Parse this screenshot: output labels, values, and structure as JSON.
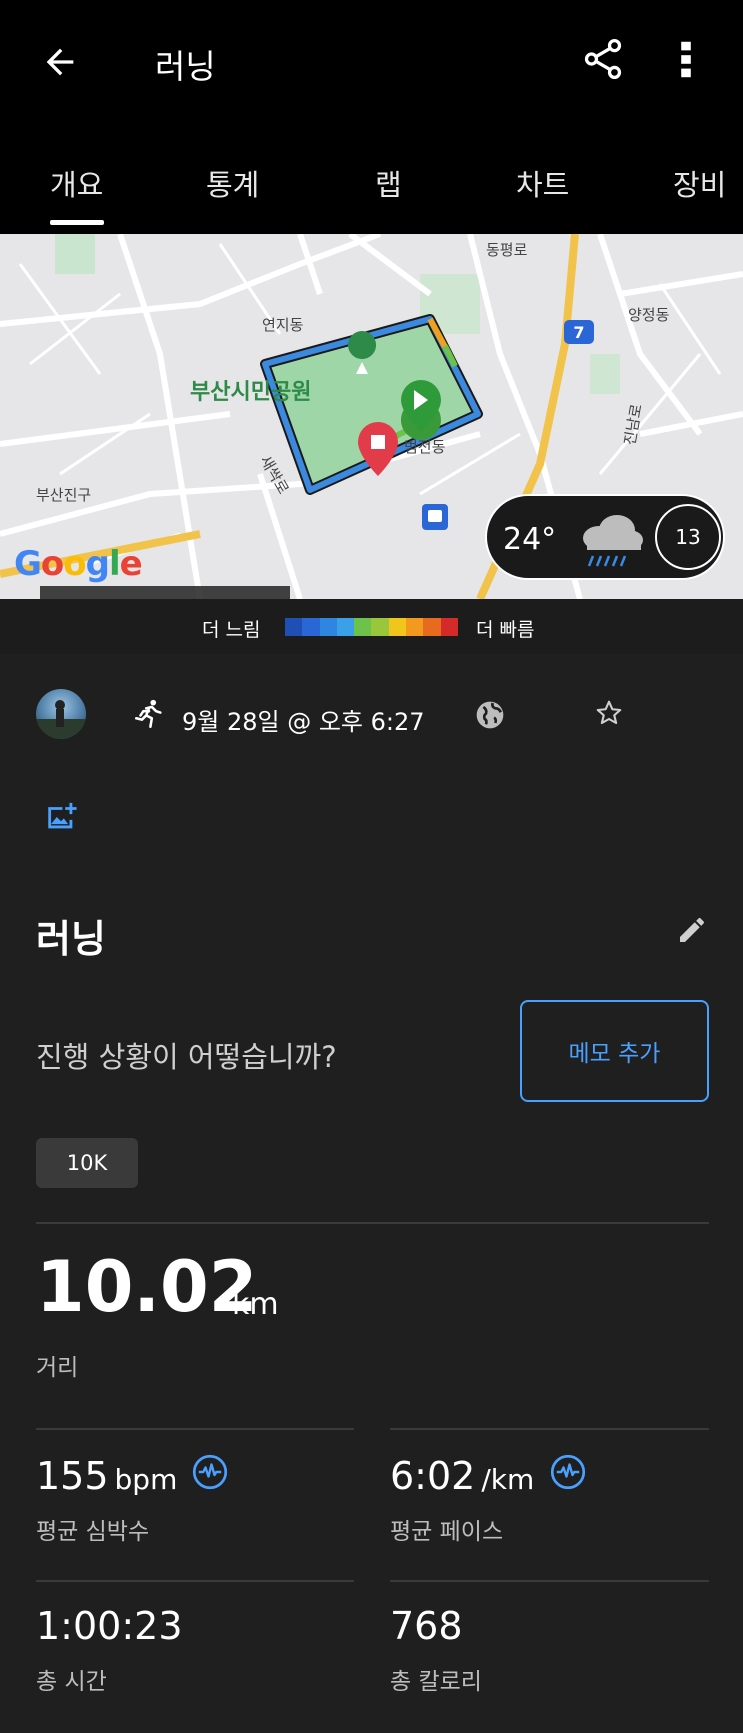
{
  "header": {
    "title": "러닝",
    "back_icon": "arrow-back-icon",
    "share_icon": "share-icon",
    "more_icon": "more-vert-icon"
  },
  "tabs": [
    {
      "label": "개요",
      "active": true
    },
    {
      "label": "통계"
    },
    {
      "label": "랩"
    },
    {
      "label": "차트"
    },
    {
      "label": "장비"
    }
  ],
  "map": {
    "labels": {
      "dongpyeong_ro": "동평로",
      "yeonji_dong": "연지동",
      "yangjeong_dong": "양정동",
      "citizen_park": "부산시민공원",
      "beomjeon_dong": "범전동",
      "busanjin_gu": "부산진구",
      "saebyeok_ro": "새싹로",
      "jinnam_ro": "진남로",
      "road_number": "7",
      "google": "Google"
    },
    "weather": {
      "temperature": "24°",
      "wind": "13",
      "icon": "rain-cloud-icon"
    }
  },
  "legend": {
    "slow_label": "더 느림",
    "fast_label": "더 빠름",
    "colors": [
      "#1f4fb5",
      "#2a66d6",
      "#2f86e0",
      "#3aa0e8",
      "#6cc24a",
      "#9ac63b",
      "#f0c51c",
      "#f39a1e",
      "#e86a1f",
      "#d42a2a"
    ]
  },
  "activity": {
    "datetime": "9월 28일 @ 오후 6:27",
    "name": "러닝",
    "question": "진행 상황이 어떻습니까?",
    "memo_button": "메모 추가",
    "tag": "10K"
  },
  "stats": {
    "distance": {
      "value": "10.02",
      "unit": "km",
      "label": "거리"
    },
    "avg_hr": {
      "value": "155",
      "unit": "bpm",
      "label": "평균 심박수"
    },
    "avg_pace": {
      "value": "6:02",
      "unit": "/km",
      "label": "평균 페이스"
    },
    "total_time": {
      "value": "1:00:23",
      "label": "총 시간"
    },
    "calories": {
      "value": "768",
      "label": "총 칼로리"
    }
  }
}
